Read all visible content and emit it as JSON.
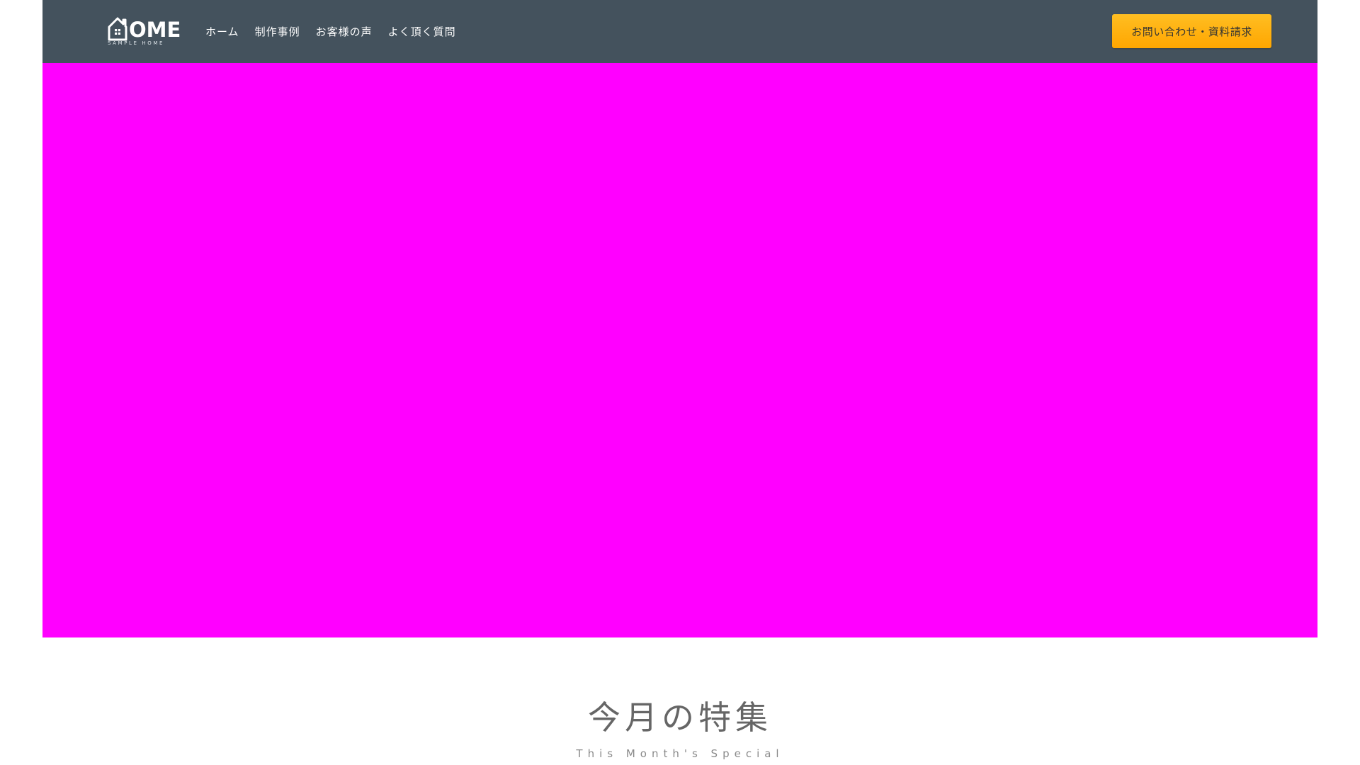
{
  "header": {
    "logo": {
      "word": "OME",
      "tagline": "SAMPLE HOME",
      "icon": "house-icon"
    },
    "nav": [
      {
        "label": "ホーム"
      },
      {
        "label": "制作事例"
      },
      {
        "label": "お客様の声"
      },
      {
        "label": "よく頂く質問"
      }
    ],
    "cta_label": "お問い合わせ・資料請求"
  },
  "hero": {
    "color": "#ff00ff"
  },
  "section": {
    "title": "今月の特集",
    "subtitle": "This Month's Special"
  },
  "colors": {
    "header_bg": "#44525d",
    "cta_bg": "#ffb000",
    "hero_placeholder": "#ff00ff"
  }
}
